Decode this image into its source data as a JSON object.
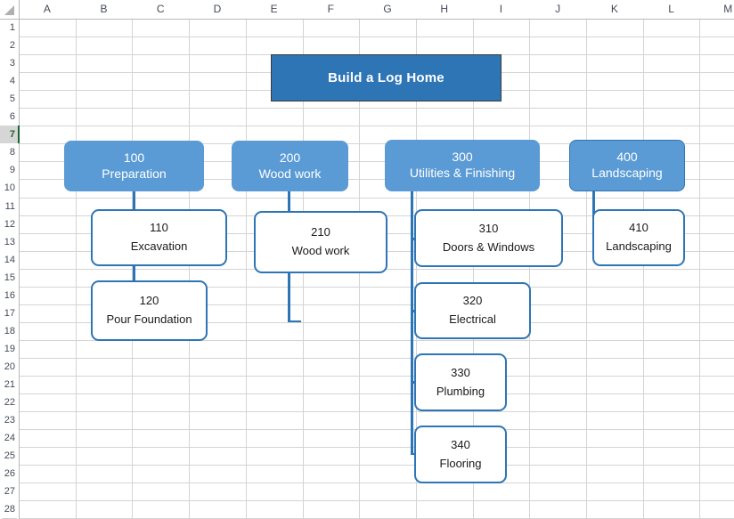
{
  "app": {
    "type": "spreadsheet",
    "select_all_icon": "select-all-triangle-icon"
  },
  "grid": {
    "columns": [
      "A",
      "B",
      "C",
      "D",
      "E",
      "F",
      "G",
      "H",
      "I",
      "J",
      "K",
      "L",
      "M"
    ],
    "rows": [
      "1",
      "2",
      "3",
      "4",
      "5",
      "6",
      "7",
      "8",
      "9",
      "10",
      "11",
      "12",
      "13",
      "14",
      "15",
      "16",
      "17",
      "18",
      "19",
      "20",
      "21",
      "22",
      "23",
      "24",
      "25",
      "26",
      "27",
      "28"
    ],
    "selected_row": "7"
  },
  "colors": {
    "title_fill": "#2E75B6",
    "title_border": "#3a3a3a",
    "level1_fill": "#5B9BD5",
    "level1_text": "#FFFFFF",
    "level2_fill": "#FFFFFF",
    "level2_border": "#2E75B6",
    "level2_text": "#1A1A1A",
    "connector": "#2E75B6",
    "gridline": "#D4D4D4",
    "header_text": "#444B57",
    "selection_accent": "#1D6230"
  },
  "diagram": {
    "kind": "work-breakdown-structure",
    "title": {
      "label": "Build a Log Home"
    },
    "branches": [
      {
        "code": "100",
        "name": "Preparation",
        "children": [
          {
            "code": "110",
            "name": "Excavation"
          },
          {
            "code": "120",
            "name": "Pour Foundation"
          }
        ]
      },
      {
        "code": "200",
        "name": "Wood work",
        "children": [
          {
            "code": "210",
            "name": "Wood work"
          }
        ]
      },
      {
        "code": "300",
        "name": "Utilities & Finishing",
        "children": [
          {
            "code": "310",
            "name": "Doors & Windows"
          },
          {
            "code": "320",
            "name": "Electrical"
          },
          {
            "code": "330",
            "name": "Plumbing"
          },
          {
            "code": "340",
            "name": "Flooring"
          }
        ]
      },
      {
        "code": "400",
        "name": "Landscaping",
        "children": [
          {
            "code": "410",
            "name": "Landscaping"
          }
        ]
      }
    ]
  }
}
